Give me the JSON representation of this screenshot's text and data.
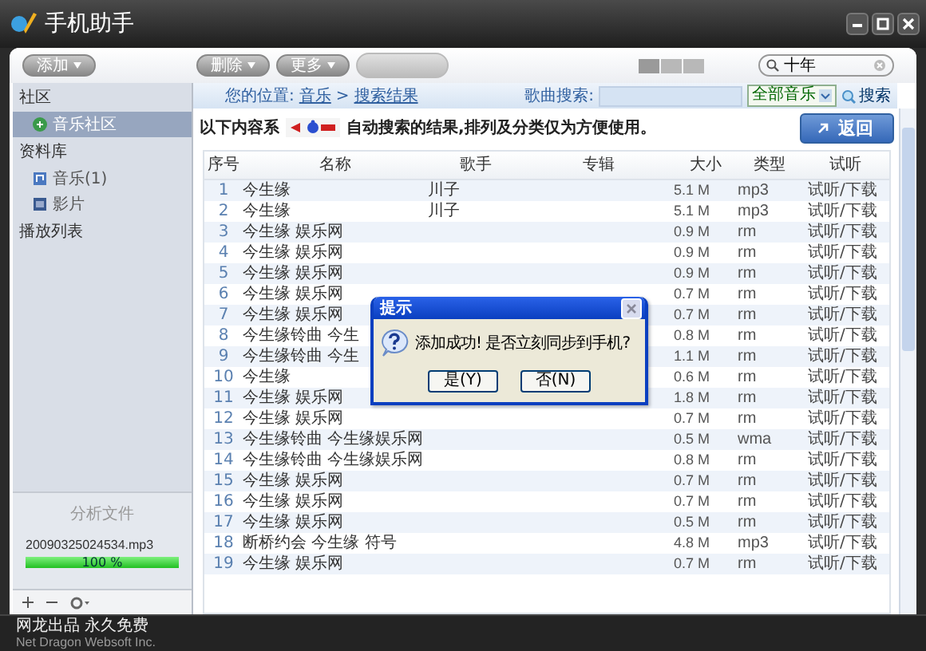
{
  "window": {
    "title": "手机助手"
  },
  "toolbar": {
    "buttons": [
      {
        "label": "添加",
        "disabled": false
      },
      {
        "label": "删除",
        "disabled": false
      },
      {
        "label": "更多",
        "disabled": false
      }
    ],
    "search": {
      "value": "十年"
    }
  },
  "sidebar": {
    "sections": [
      {
        "title": "社区",
        "items": [
          {
            "label": "音乐社区",
            "kind": "community",
            "selected": true
          }
        ]
      },
      {
        "title": "资料库",
        "items": [
          {
            "label": "音乐(1)",
            "kind": "music",
            "selected": false
          },
          {
            "label": "影片",
            "kind": "movie",
            "selected": false
          }
        ]
      },
      {
        "title": "播放列表"
      }
    ],
    "analysis": {
      "title": "分析文件",
      "file": "20090325024534.mp3",
      "level": 1,
      "reading": "100 %"
    }
  },
  "main": {
    "breadcrumb_label": "您的位置:",
    "breadcrumb": [
      "音乐",
      "搜索结果"
    ],
    "breadcrumb_sep": ">",
    "search_label": "歌曲搜索:",
    "scope": "全部音乐",
    "search_button": "搜索",
    "notice_before": "以下内容系",
    "notice_after": "自动搜索的结果,排列及分类仅为方便使用。",
    "back_button": "返回"
  },
  "table": {
    "columns": [
      "序号",
      "名称",
      "歌手",
      "专辑",
      "大小",
      "类型",
      "试听"
    ],
    "rows": [
      {
        "num": "1",
        "name": "今生缘",
        "singer": "川子",
        "size": "5.1 M",
        "type": "mp3",
        "action": "试听/下载"
      },
      {
        "num": "2",
        "name": "今生缘",
        "singer": "川子",
        "size": "5.1 M",
        "type": "mp3",
        "action": "试听/下载"
      },
      {
        "num": "3",
        "name": "今生缘 娱乐网",
        "size": "0.9 M",
        "type": "rm",
        "action": "试听/下载"
      },
      {
        "num": "4",
        "name": "今生缘 娱乐网",
        "size": "0.9 M",
        "type": "rm",
        "action": "试听/下载"
      },
      {
        "num": "5",
        "name": "今生缘 娱乐网",
        "size": "0.9 M",
        "type": "rm",
        "action": "试听/下载"
      },
      {
        "num": "6",
        "name": "今生缘 娱乐网",
        "size": "0.7 M",
        "type": "rm",
        "action": "试听/下载"
      },
      {
        "num": "7",
        "name": "今生缘 娱乐网",
        "size": "0.7 M",
        "type": "rm",
        "action": "试听/下载"
      },
      {
        "num": "8",
        "name": "今生缘铃曲 今生",
        "size": "0.8 M",
        "type": "rm",
        "action": "试听/下载"
      },
      {
        "num": "9",
        "name": "今生缘铃曲 今生",
        "size": "1.1 M",
        "type": "rm",
        "action": "试听/下载"
      },
      {
        "num": "10",
        "name": "今生缘",
        "size": "0.6 M",
        "type": "rm",
        "action": "试听/下载"
      },
      {
        "num": "11",
        "name": "今生缘 娱乐网",
        "size": "1.8 M",
        "type": "rm",
        "action": "试听/下载"
      },
      {
        "num": "12",
        "name": "今生缘 娱乐网",
        "size": "0.7 M",
        "type": "rm",
        "action": "试听/下载"
      },
      {
        "num": "13",
        "name": "今生缘铃曲 今生缘娱乐网",
        "size": "0.5 M",
        "type": "wma",
        "action": "试听/下载"
      },
      {
        "num": "14",
        "name": "今生缘铃曲 今生缘娱乐网",
        "size": "0.8 M",
        "type": "rm",
        "action": "试听/下载"
      },
      {
        "num": "15",
        "name": "今生缘 娱乐网",
        "size": "0.7 M",
        "type": "rm",
        "action": "试听/下载"
      },
      {
        "num": "16",
        "name": "今生缘 娱乐网",
        "size": "0.7 M",
        "type": "rm",
        "action": "试听/下载"
      },
      {
        "num": "17",
        "name": "今生缘 娱乐网",
        "size": "0.5 M",
        "type": "rm",
        "action": "试听/下载"
      },
      {
        "num": "18",
        "name": "断桥约会 今生缘 符号",
        "size": "4.8 M",
        "type": "mp3",
        "action": "试听/下载"
      },
      {
        "num": "19",
        "name": "今生缘 娱乐网",
        "size": "0.7 M",
        "type": "rm",
        "action": "试听/下载"
      }
    ]
  },
  "dialog": {
    "title": "提示",
    "message": "添加成功! 是否立刻同步到手机?",
    "buttons": [
      "是(Y)",
      "否(N)"
    ]
  },
  "footer": {
    "line1": "网龙出品 永久免费",
    "line2": "Net Dragon Websoft Inc."
  }
}
